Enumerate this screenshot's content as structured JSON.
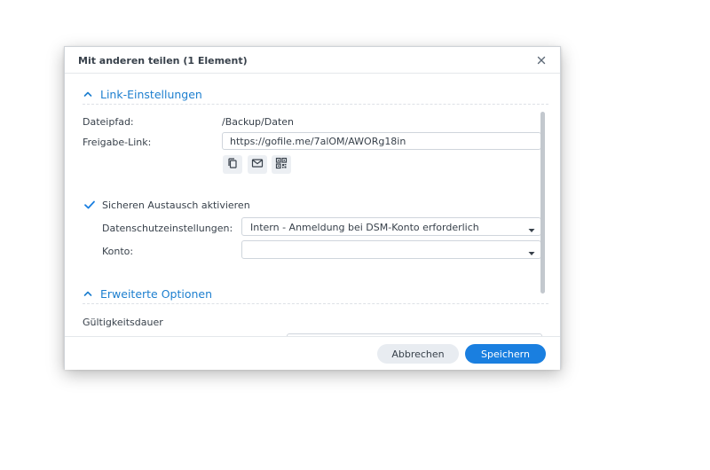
{
  "dialog": {
    "title": "Mit anderen teilen (1 Element)",
    "close_icon": "close-icon"
  },
  "link_settings": {
    "header": "Link-Einstellungen",
    "expanded": true,
    "file_path_label": "Dateipfad:",
    "file_path_value": "/Backup/Daten",
    "share_link_label": "Freigabe-Link:",
    "share_link_value": "https://gofile.me/7alOM/AWORg18in",
    "actions": [
      {
        "icon": "copy-icon"
      },
      {
        "icon": "mail-icon"
      },
      {
        "icon": "qr-code-icon"
      }
    ]
  },
  "secure_sharing": {
    "checkbox_label": "Sicheren Austausch aktivieren",
    "checked": true,
    "privacy_label": "Datenschutzeinstellungen:",
    "privacy_value": "Intern - Anmeldung bei DSM-Konto erforderlich",
    "account_label": "Konto:",
    "account_value": ""
  },
  "advanced": {
    "header": "Erweiterte Optionen",
    "expanded": true,
    "validity_label": "Gültigkeitsdauer"
  },
  "footer": {
    "cancel_label": "Abbrechen",
    "save_label": "Speichern"
  },
  "colors": {
    "accent": "#1a7fe0",
    "section_header": "#1d7fcf",
    "text": "#38414b"
  }
}
